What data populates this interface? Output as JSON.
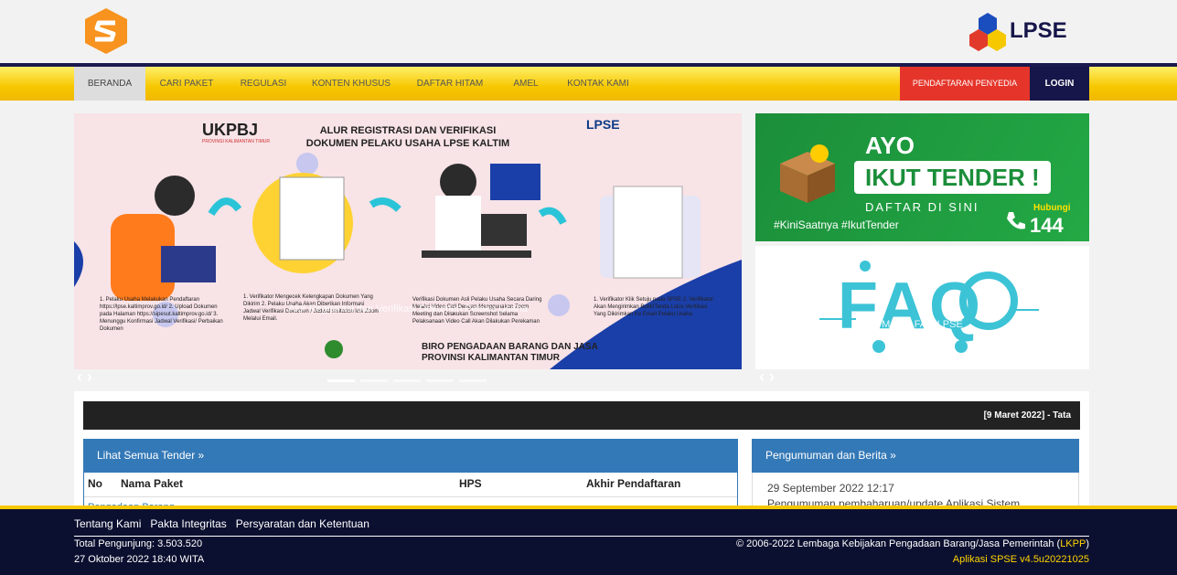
{
  "nav": {
    "items": [
      "BERANDA",
      "CARI PAKET",
      "REGULASI",
      "KONTEN KHUSUS",
      "DAFTAR HITAM",
      "AMEL",
      "KONTAK KAMI"
    ],
    "register": "PENDAFTARAN PENYEDIA",
    "login": "LOGIN"
  },
  "brand": {
    "lpse": "LPSE"
  },
  "carousel": {
    "logo": "UKPBJ",
    "logo_sub": "PROVINSI KALIMANTAN TIMUR",
    "lpse": "LPSE",
    "title_line1": "ALUR REGISTRASI DAN VERIFIKASI",
    "title_line2": "DOKUMEN PELAKU USAHA LPSE KALTIM",
    "caption": "Alur Registrasi dan Verifikasi Dokumen Pelaku Usaha",
    "steps": [
      "1. Pelaku Usaha Melakukan Pendaftaran https://lpse.kaltimprov.go.id/ 2. Upload Dokumen pada Halaman https://sipesut.kaltimprov.go.id/ 3. Menunggu Konfirmasi Jadwal Verifikasi/ Perbaikan Dokumen",
      "1. Verifikator Mengecek Kelengkapan Dokumen Yang Dikirim 2. Pelaku Usaha Akan Diberikan Informasi Jadwal Verifikasi Dokumen / Jadwal invitation link Zoom Melalui Email.",
      "Verifikasi Dokumen Asli Pelaku Usaha Secara Daring Melalui Video Call Dengan Menggunakan Zoom Meeting dan Dilakukan Screenshot Selama Pelaksanaan Video Call Akan Dilakukan Perekaman",
      "1. Verifikator Klik Setuju pada SPSE 2. Verifikator Akan Mengirimkan Bukti/Tanda Lulus Verifikasi Yang Dikirimkan Ke Email Pelaku Usaha"
    ],
    "biro_line1": "BIRO PENGADAAN BARANG DAN JASA",
    "biro_line2": "PROVINSI KALIMANTAN TIMUR"
  },
  "banner_tender": {
    "ayo": "AYO",
    "ikut": "IKUT TENDER !",
    "daftar": "DAFTAR DI SINI",
    "hashtag": "#KiniSaatnya #IkutTender",
    "hubungi": "Hubungi",
    "number": "144"
  },
  "banner_faq": {
    "big": "FAQ",
    "caption": "Mobile FAQ LPSE"
  },
  "ticker": "[9 Maret 2022] - Tata",
  "tender": {
    "heading": "Lihat Semua Tender »",
    "cols": [
      "No",
      "Nama Paket",
      "HPS",
      "Akhir Pendaftaran"
    ],
    "first_row": "Pengadaan Barang"
  },
  "news": {
    "heading": "Pengumuman dan Berita »",
    "date": "29 September 2022 12:17",
    "title": "Pengumuman pembaharuan/update Aplikasi Sistem"
  },
  "footer": {
    "links": [
      "Tentang Kami",
      "Pakta Integritas",
      "Persyaratan dan Ketentuan"
    ],
    "visitors": "Total Pengunjung: 3.503.520",
    "datetime": "27 Oktober 2022 18:40 WITA",
    "copyright": "© 2006-2022 Lembaga Kebijakan Pengadaan Barang/Jasa Pemerintah (",
    "lkpp": "LKPP",
    "copyright_end": ")",
    "version": "Aplikasi SPSE v4.5u20221025"
  },
  "colors": {
    "brand_navy": "#16164a",
    "brand_yellow": "#f6c700",
    "register_red": "#e5352a",
    "panel_blue": "#3479b7"
  }
}
